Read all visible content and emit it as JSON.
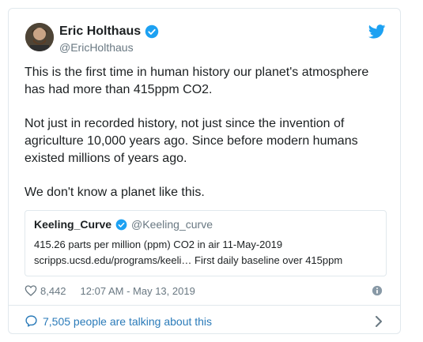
{
  "tweet": {
    "author_name": "Eric Holthaus",
    "author_handle": "@EricHolthaus",
    "paragraphs": [
      "This is the first time in human history our planet's atmosphere has had more than 415ppm CO2.",
      "Not just in recorded history, not just since the invention of agriculture 10,000 years ago. Since before modern humans existed millions of years ago.",
      "We don't know a planet like this."
    ],
    "likes": "8,442",
    "timestamp": "12:07 AM - May 13, 2019",
    "talking": "7,505 people are talking about this"
  },
  "quote": {
    "name": "Keeling_Curve",
    "handle": "@Keeling_curve",
    "line1": "415.26 parts per million (ppm) CO2 in air 11-May-2019",
    "line2": "scripps.ucsd.edu/programs/keeli…  First daily baseline over 415ppm"
  },
  "colors": {
    "verified": "#1da1f2",
    "link": "#2b7bb9",
    "muted": "#697882",
    "border": "#e1e8ed"
  },
  "icons": [
    "verified-badge-icon",
    "twitter-bird-icon",
    "heart-icon",
    "info-icon",
    "reply-bubble-icon",
    "chevron-right-icon"
  ]
}
